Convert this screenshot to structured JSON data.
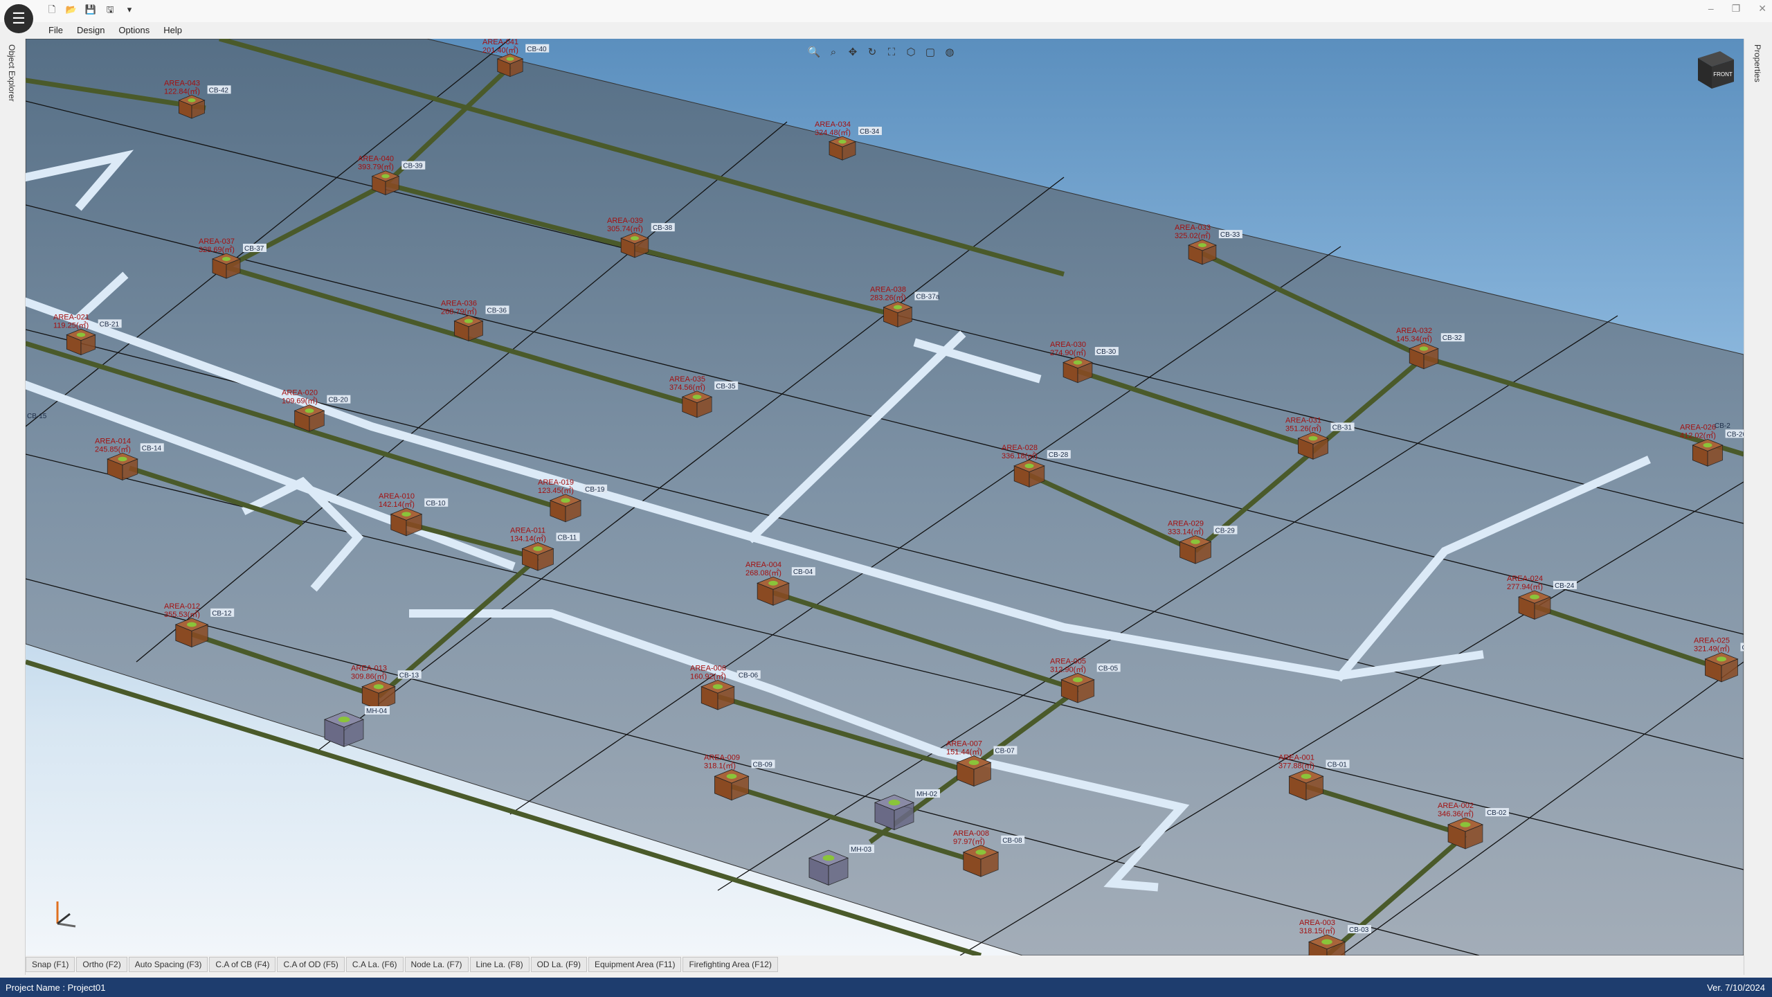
{
  "app": {
    "menu": [
      "File",
      "Design",
      "Options",
      "Help"
    ],
    "window_controls": [
      "–",
      "❐",
      "✕"
    ],
    "qat_icons": [
      "new-file-icon",
      "open-folder-icon",
      "save-icon",
      "save-as-icon",
      "customize-icon"
    ]
  },
  "docks": {
    "left": "Object Explorer",
    "right": "Properties"
  },
  "viewport": {
    "viewcube_face": "FRONT",
    "tool_icons": [
      "zoom-window-icon",
      "zoom-icon",
      "pan-icon",
      "rotate-icon",
      "zoom-extents-icon",
      "view-3d-icon",
      "view-box-icon",
      "view-sphere-icon"
    ]
  },
  "catch_basins": [
    {
      "area": "AREA-041",
      "amount": "201.40(㎡)",
      "cb": "CB-40"
    },
    {
      "area": "AREA-043",
      "amount": "122.84(㎡)",
      "cb": "CB-42"
    },
    {
      "area": "AREA-040",
      "amount": "393.79(㎡)",
      "cb": "CB-39"
    },
    {
      "area": "AREA-034",
      "amount": "324.48(㎡)",
      "cb": "CB-34"
    },
    {
      "area": "AREA-037",
      "amount": "328.69(㎡)",
      "cb": "CB-37"
    },
    {
      "area": "AREA-039",
      "amount": "305.74(㎡)",
      "cb": "CB-38"
    },
    {
      "area": "AREA-033",
      "amount": "325.02(㎡)",
      "cb": "CB-33"
    },
    {
      "area": "AREA-038",
      "amount": "283.26(㎡)",
      "cb": "CB-37a"
    },
    {
      "area": "AREA-036",
      "amount": "268.79(㎡)",
      "cb": "CB-36"
    },
    {
      "area": "AREA-021",
      "amount": "119.25(㎡)",
      "cb": "CB-21"
    },
    {
      "area": "AREA-032",
      "amount": "145.34(㎡)",
      "cb": "CB-32"
    },
    {
      "area": "AREA-035",
      "amount": "374.56(㎡)",
      "cb": "CB-35"
    },
    {
      "area": "AREA-030",
      "amount": "274.90(㎡)",
      "cb": "CB-30"
    },
    {
      "area": "AREA-020",
      "amount": "109.69(㎡)",
      "cb": "CB-20"
    },
    {
      "area": "AREA-031",
      "amount": "351.26(㎡)",
      "cb": "CB-31"
    },
    {
      "area": "AREA-014",
      "amount": "245.85(㎡)",
      "cb": "CB-14"
    },
    {
      "area": "AREA-028",
      "amount": "336.18(㎡)",
      "cb": "CB-28"
    },
    {
      "area": "AREA-026",
      "amount": "412.02(㎡)",
      "cb": "CB-26"
    },
    {
      "area": "AREA-019",
      "amount": "123.45(㎡)",
      "cb": "CB-19"
    },
    {
      "area": "AREA-010",
      "amount": "142.14(㎡)",
      "cb": "CB-10"
    },
    {
      "area": "AREA-029",
      "amount": "333.14(㎡)",
      "cb": "CB-29"
    },
    {
      "area": "AREA-011",
      "amount": "134.14(㎡)",
      "cb": "CB-11"
    },
    {
      "area": "AREA-004",
      "amount": "268.08(㎡)",
      "cb": "CB-04"
    },
    {
      "area": "AREA-024",
      "amount": "277.94(㎡)",
      "cb": "CB-24"
    },
    {
      "area": "AREA-012",
      "amount": "355.53(㎡)",
      "cb": "CB-12"
    },
    {
      "area": "AREA-006",
      "amount": "160.92(㎡)",
      "cb": "CB-06"
    },
    {
      "area": "AREA-005",
      "amount": "312.90(㎡)",
      "cb": "CB-05"
    },
    {
      "area": "AREA-025",
      "amount": "321.49(㎡)",
      "cb": "CB-25"
    },
    {
      "area": "AREA-013",
      "amount": "309.86(㎡)",
      "cb": "CB-13"
    },
    {
      "area": "AREA-007",
      "amount": "151.44(㎡)",
      "cb": "CB-07"
    },
    {
      "area": "AREA-009",
      "amount": "318.1(㎡)",
      "cb": "CB-09"
    },
    {
      "area": "AREA-001",
      "amount": "377.88(㎡)",
      "cb": "CB-01"
    },
    {
      "area": "AREA-002",
      "amount": "346.36(㎡)",
      "cb": "CB-02"
    },
    {
      "area": "AREA-008",
      "amount": "97.97(㎡)",
      "cb": "CB-08"
    },
    {
      "area": "AREA-003",
      "amount": "318.15(㎡)",
      "cb": "CB-03"
    }
  ],
  "manholes": [
    "MH-04",
    "MH-02",
    "MH-03"
  ],
  "edge_labels": [
    "CB-15",
    "CB-2"
  ],
  "tabs": [
    "Snap (F1)",
    "Ortho (F2)",
    "Auto Spacing (F3)",
    "C.A of CB (F4)",
    "C.A of OD (F5)",
    "C.A La. (F6)",
    "Node La. (F7)",
    "Line La. (F8)",
    "OD La. (F9)",
    "Equipment Area (F11)",
    "Firefighting Area (F12)"
  ],
  "status": {
    "project": "Project Name : Project01",
    "version": "Ver. 7/10/2024"
  },
  "colors": {
    "pipe": "#4a5a2a",
    "basin": "#8a4a22",
    "manhole": "#6a6a86",
    "road": "#c7dff2",
    "slab": "#6e849a",
    "area_label": "#a31010",
    "status_bar": "#1e3d6e"
  }
}
